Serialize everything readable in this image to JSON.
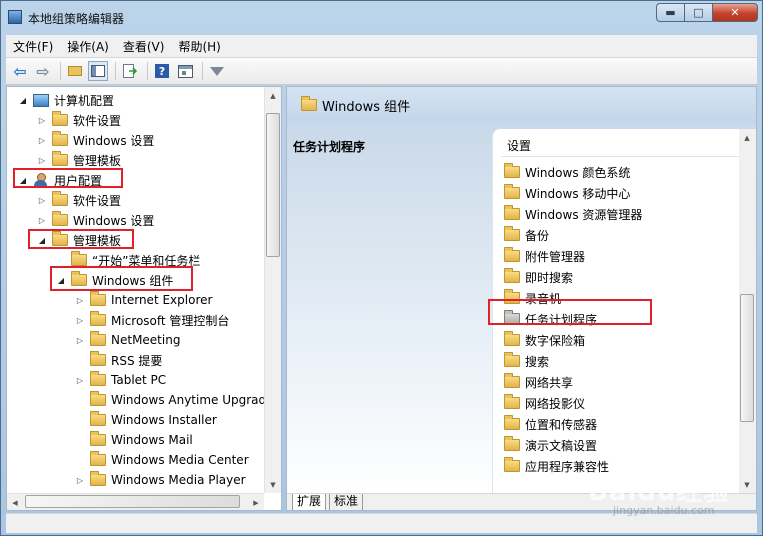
{
  "window": {
    "title": "本地组策略编辑器",
    "min_glyph": "▬",
    "max_glyph": "□",
    "close_glyph": "✕"
  },
  "menu": [
    "文件(F)",
    "操作(A)",
    "查看(V)",
    "帮助(H)"
  ],
  "toolbar": {
    "icons": [
      "back-arrow-icon",
      "forward-arrow-icon",
      "up-folder-icon",
      "show-hide-tree-icon",
      "export-list-icon",
      "help-icon",
      "properties-icon",
      "filter-icon"
    ],
    "help_glyph": "?"
  },
  "tree": {
    "items": [
      {
        "label": "计算机配置",
        "expander": "◢"
      },
      {
        "label": "软件设置",
        "expander": "▷"
      },
      {
        "label": "Windows 设置",
        "expander": "▷"
      },
      {
        "label": "管理模板",
        "expander": "▷"
      },
      {
        "label": "用户配置",
        "expander": "◢"
      },
      {
        "label": "软件设置",
        "expander": "▷"
      },
      {
        "label": "Windows 设置",
        "expander": "▷"
      },
      {
        "label": "管理模板",
        "expander": "◢"
      },
      {
        "label": "“开始”菜单和任务栏",
        "expander": ""
      },
      {
        "label": "Windows 组件",
        "expander": "◢"
      },
      {
        "label": "Internet Explorer",
        "expander": "▷"
      },
      {
        "label": "Microsoft 管理控制台",
        "expander": "▷"
      },
      {
        "label": "NetMeeting",
        "expander": "▷"
      },
      {
        "label": "RSS 提要",
        "expander": ""
      },
      {
        "label": "Tablet PC",
        "expander": "▷"
      },
      {
        "label": "Windows Anytime Upgrade",
        "expander": ""
      },
      {
        "label": "Windows Installer",
        "expander": ""
      },
      {
        "label": "Windows Mail",
        "expander": ""
      },
      {
        "label": "Windows Media Center",
        "expander": ""
      },
      {
        "label": "Windows Media Player",
        "expander": "▷"
      }
    ],
    "scroll_up": "▲",
    "scroll_down": "▼",
    "scroll_left": "◀",
    "scroll_right": "▶"
  },
  "right": {
    "header": "Windows 组件",
    "description_title": "任务计划程序",
    "settings_header": "设置",
    "items": [
      "Windows 颜色系统",
      "Windows 移动中心",
      "Windows 资源管理器",
      "备份",
      "附件管理器",
      "即时搜索",
      "录音机",
      "任务计划程序",
      "数字保险箱",
      "搜索",
      "网络共享",
      "网络投影仪",
      "位置和传感器",
      "演示文稿设置",
      "应用程序兼容性"
    ],
    "tabs": [
      "扩展",
      "标准"
    ]
  },
  "watermark": {
    "text": "Baidu经验",
    "sub": "jingyan.baidu.com"
  },
  "colors": {
    "highlight_red": "#e0202a",
    "folder_yellow": "#e8c35e",
    "window_blue": "#a9c6e2"
  }
}
